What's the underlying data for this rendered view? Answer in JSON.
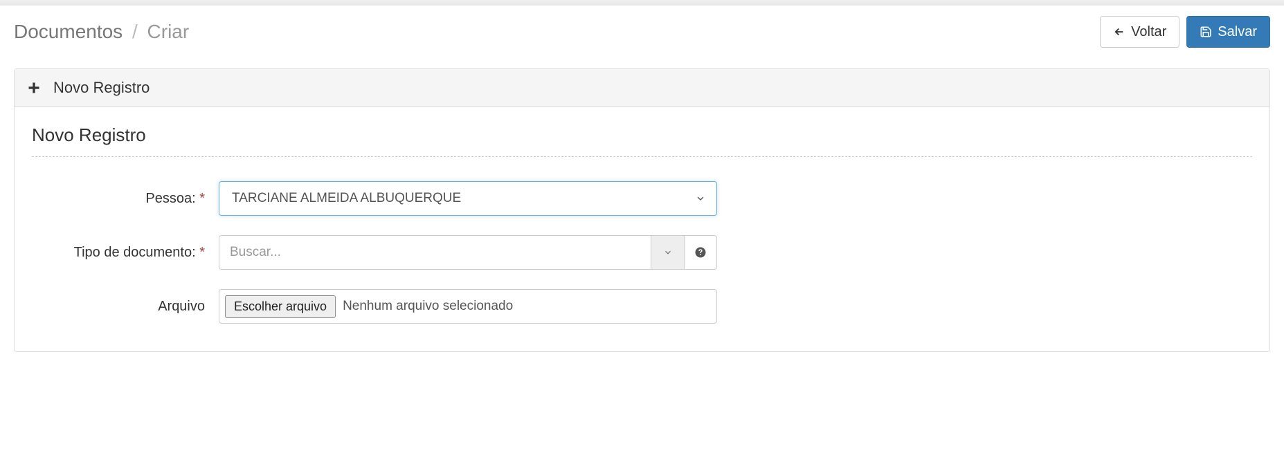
{
  "breadcrumb": {
    "root": "Documentos",
    "current": "Criar"
  },
  "buttons": {
    "back": "Voltar",
    "save": "Salvar"
  },
  "panel": {
    "heading": "Novo Registro",
    "section_title": "Novo Registro"
  },
  "form": {
    "pessoa": {
      "label": "Pessoa:",
      "value": "TARCIANE ALMEIDA ALBUQUERQUE"
    },
    "tipo_documento": {
      "label": "Tipo de documento:",
      "placeholder": "Buscar..."
    },
    "arquivo": {
      "label": "Arquivo",
      "button": "Escolher arquivo",
      "status": "Nenhum arquivo selecionado"
    }
  }
}
